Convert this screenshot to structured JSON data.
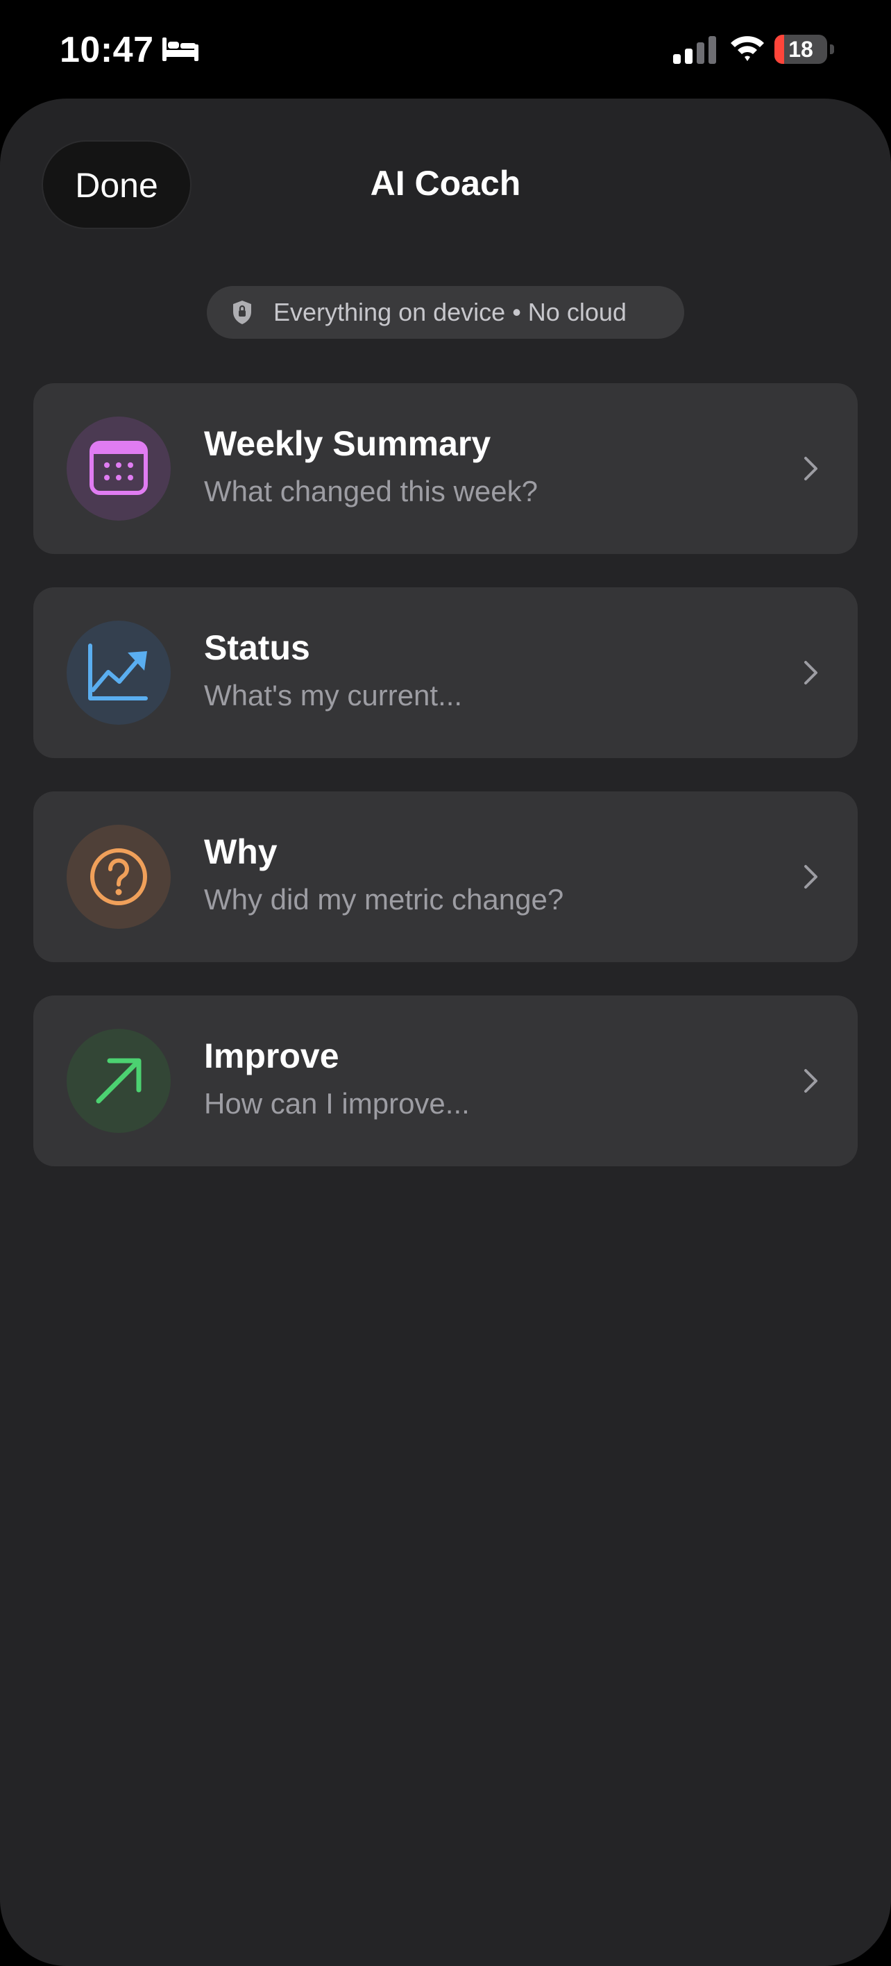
{
  "status_bar": {
    "time": "10:47",
    "battery_level": "18",
    "battery_fraction": 0.18,
    "icons": [
      "bed-icon",
      "signal-icon",
      "wifi-icon",
      "battery-icon"
    ]
  },
  "header": {
    "done_label": "Done",
    "title": "AI Coach"
  },
  "privacy": {
    "icon": "shield-icon",
    "text": "Everything on device • No cloud"
  },
  "cards": [
    {
      "title": "Weekly Summary",
      "subtitle": "What changed this week?",
      "icon": "calendar-icon",
      "color": "#e07cf2",
      "bg": "#4b3a52"
    },
    {
      "title": "Status",
      "subtitle": "What's my current...",
      "icon": "trend-chart-icon",
      "color": "#5aaef0",
      "bg": "#34404f"
    },
    {
      "title": "Why",
      "subtitle": "Why did my metric change?",
      "icon": "question-icon",
      "color": "#f0a05a",
      "bg": "#4f4038"
    },
    {
      "title": "Improve",
      "subtitle": "How can I improve...",
      "icon": "arrow-up-right-icon",
      "color": "#4cd271",
      "bg": "#334636"
    }
  ],
  "colors": {
    "sheet_bg": "#242426",
    "card_bg": "#353537",
    "pill_bg": "#3a3a3c",
    "battery_low": "#ff453a"
  }
}
